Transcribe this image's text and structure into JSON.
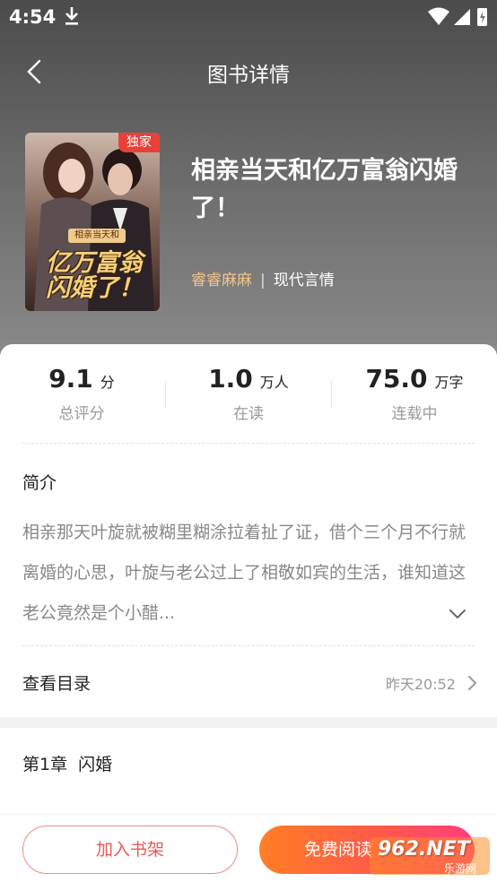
{
  "status_bar": {
    "time": "4:54"
  },
  "header": {
    "title": "图书详情"
  },
  "book": {
    "cover_badge": "独家",
    "cover_subtitle": "相亲当天和",
    "cover_title": "亿万富翁闪婚了！",
    "title": "相亲当天和亿万富翁闪婚了！",
    "author": "睿睿麻麻",
    "separator": "|",
    "genre": "现代言情"
  },
  "stats": [
    {
      "value": "9.1",
      "unit": "分",
      "label": "总评分"
    },
    {
      "value": "1.0",
      "unit": "万人",
      "label": "在读"
    },
    {
      "value": "75.0",
      "unit": "万字",
      "label": "连载中"
    }
  ],
  "intro": {
    "heading": "简介",
    "text": "相亲那天叶旋就被糊里糊涂拉着扯了证，借个三个月不行就离婚的心思，叶旋与老公过上了相敬如宾的生活，谁知道这老公竟然是个小醋..."
  },
  "catalog": {
    "label": "查看目录",
    "updated": "昨天20:52"
  },
  "chapter": {
    "title": "第1章  闪婚"
  },
  "bottom": {
    "add_shelf": "加入书架",
    "read_free": "免费阅读"
  },
  "watermark": {
    "text": "962.NET",
    "sub": "乐游网"
  },
  "colors": {
    "accent_orange": "#ff7e24",
    "accent_pink": "#ff3d7d",
    "author_gold": "#f3c58a",
    "badge_red": "#e8413a"
  }
}
